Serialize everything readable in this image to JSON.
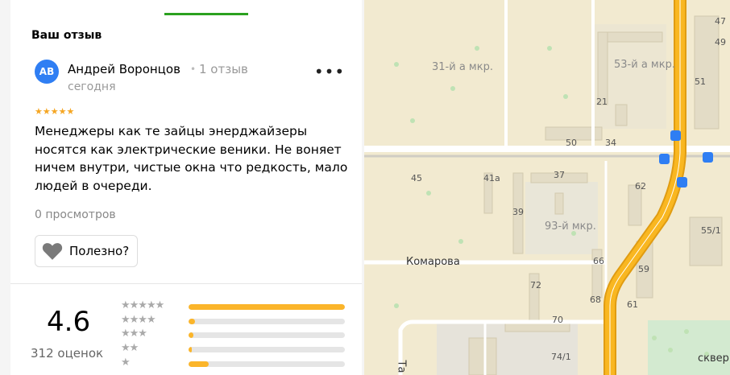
{
  "review_section": {
    "title": "Ваш отзыв",
    "author": {
      "initials": "АВ",
      "name": "Андрей Воронцов",
      "reviews_count": "1 отзыв",
      "date": "сегодня"
    },
    "rating_stars": "★★★★★",
    "rating_value": 5,
    "text": "Менеджеры как те зайцы энерджайзеры носятся как электрические веники. Не воняет ничем внутри, чистые окна что редкость, мало людей в очереди.",
    "views": "0 просмотров",
    "useful_button": "Полезно?",
    "more_icon": "more-horizontal-icon"
  },
  "summary": {
    "rating": "4.6",
    "count": "312 оценок",
    "distribution": [
      {
        "stars": "★★★★★",
        "fraction": 1.0
      },
      {
        "stars": "★★★★",
        "fraction": 0.04
      },
      {
        "stars": "★★★",
        "fraction": 0.03
      },
      {
        "stars": "★★",
        "fraction": 0.02
      },
      {
        "stars": "★",
        "fraction": 0.13
      }
    ]
  },
  "map": {
    "districts": [
      "31-й а мкр.",
      "53-й а мкр.",
      "93-й мкр."
    ],
    "streets": [
      "Комарова",
      "сквер",
      "Та"
    ],
    "house_numbers": [
      "47",
      "49",
      "51",
      "21",
      "50",
      "34",
      "45",
      "41а",
      "37",
      "62",
      "39",
      "55/1",
      "66",
      "59",
      "72",
      "68",
      "61",
      "70",
      "74/1"
    ],
    "colors": {
      "highway": "#f9b721",
      "highway_edge": "#e09c12",
      "road": "#ffffff",
      "land": "#f2ead0",
      "park": "#d3ead0"
    }
  }
}
